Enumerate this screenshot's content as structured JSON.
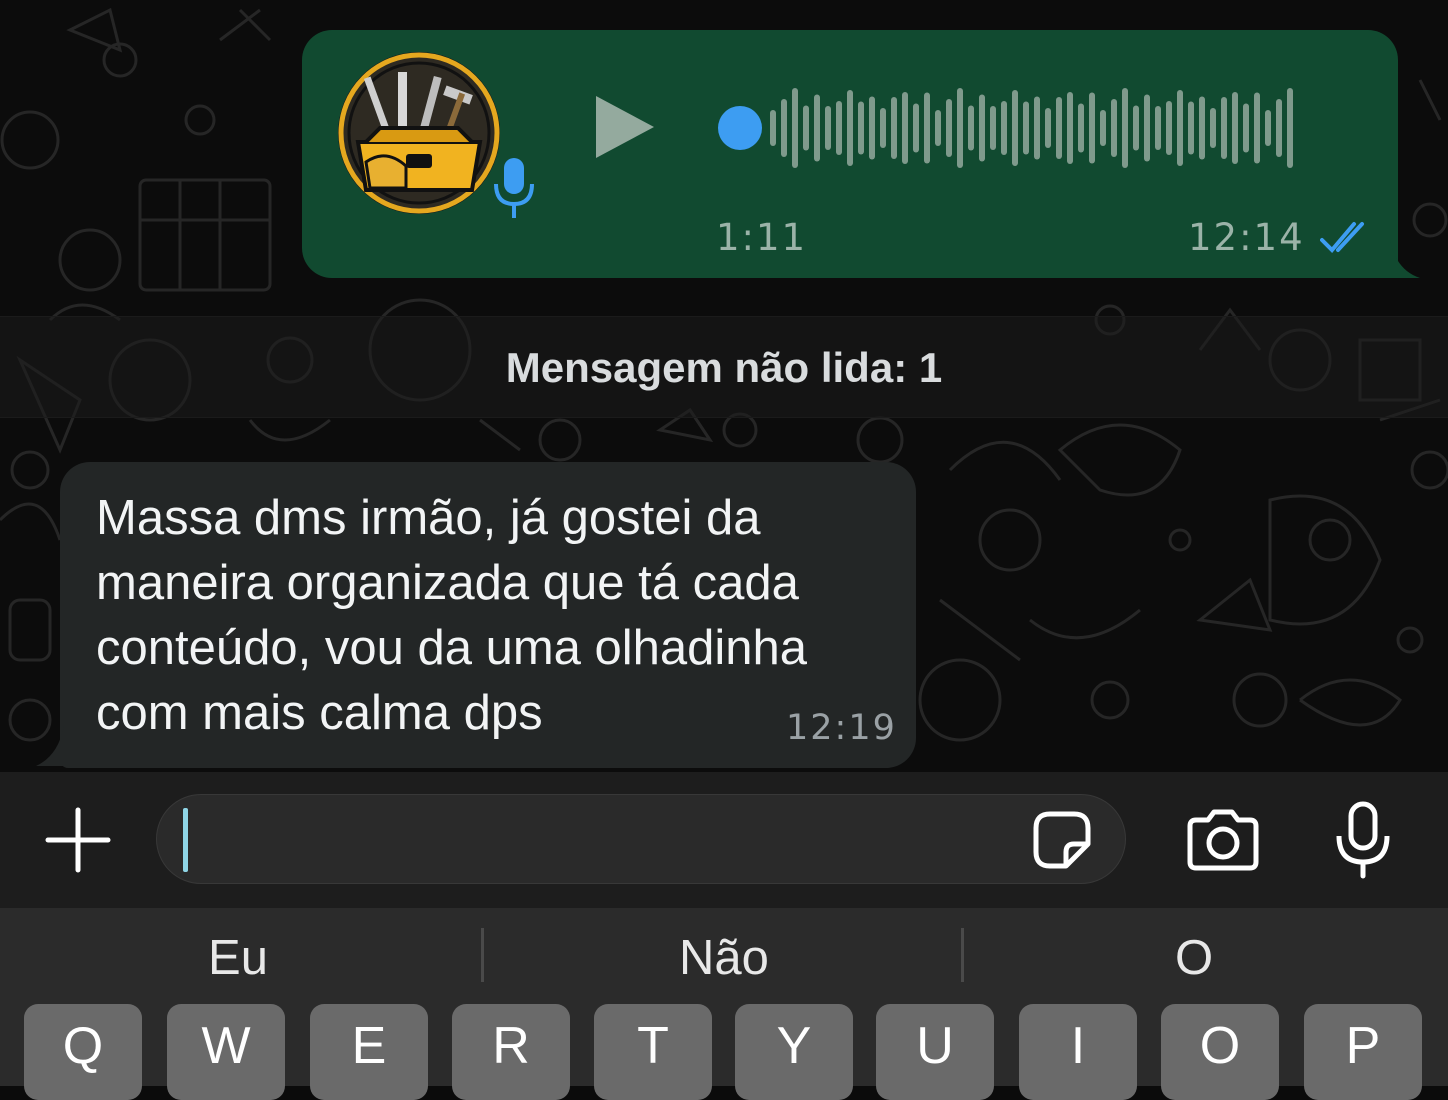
{
  "voice_message": {
    "avatar_icon": "toolbox-avatar",
    "duration": "1:11",
    "time": "12:14",
    "status": "read",
    "bubble_color": "#114a30",
    "accent_color": "#3d9df2"
  },
  "unread_banner": {
    "text": "Mensagem não lida: 1"
  },
  "incoming_message": {
    "text": "Massa dms irmão, já gostei da\nmaneira organizada que tá cada\nconteúdo, vou da uma olhadinha\ncom mais calma dps",
    "time": "12:19",
    "bubble_color": "#232626"
  },
  "composer": {
    "input_value": "",
    "plus_icon": "plus-icon",
    "sticker_icon": "sticker-icon",
    "camera_icon": "camera-icon",
    "mic_icon": "microphone-icon"
  },
  "keyboard": {
    "suggestions": [
      "Eu",
      "Não",
      "O"
    ],
    "keys": [
      "Q",
      "W",
      "E",
      "R",
      "T",
      "Y",
      "U",
      "I",
      "O",
      "P"
    ]
  }
}
